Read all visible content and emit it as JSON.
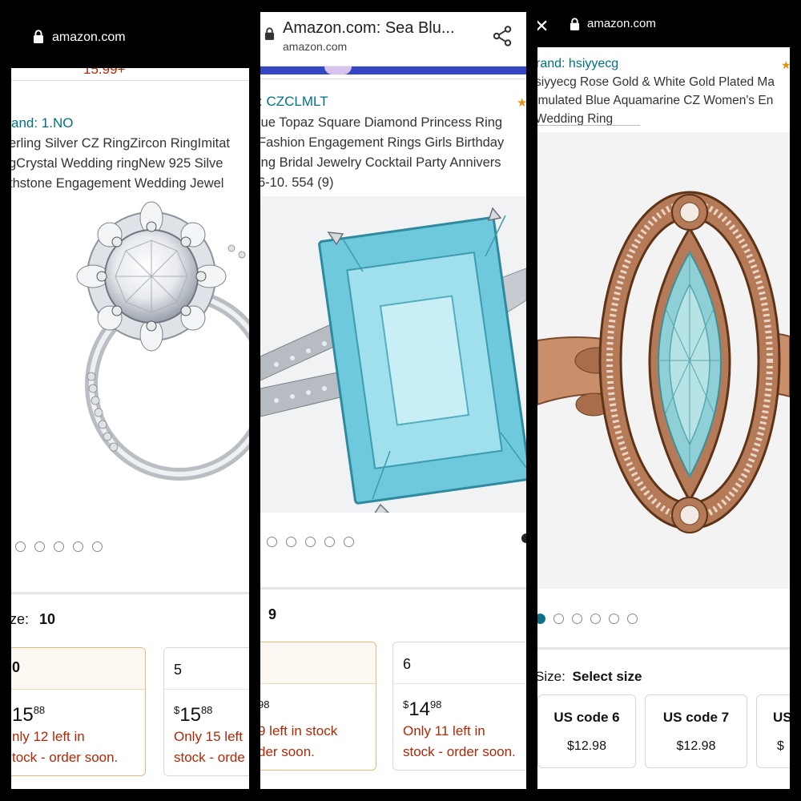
{
  "panels": [
    {
      "url": "amazon.com",
      "price_peek": "15.99+",
      "brand": "and: 1.NO",
      "title_lines": [
        "erling Silver CZ RingZircon RingImitat",
        "gCrystal Wedding ringNew 925 Silve",
        "thstone Engagement Wedding Jewel"
      ],
      "image_label": "silver-cz-ring-image",
      "size_label": "ze:",
      "size_value": "10",
      "cards": [
        {
          "size": "0",
          "price_sym": "",
          "price_whole": "15",
          "price_frac": "88",
          "stock_lines": [
            "nly 12 left in",
            "tock - order soon."
          ]
        },
        {
          "size": "5",
          "price_sym": "$",
          "price_whole": "15",
          "price_frac": "88",
          "stock_lines": [
            "Only 15 left",
            "stock - orde"
          ]
        }
      ]
    },
    {
      "title": "Amazon.com: Sea Blu...",
      "url": "amazon.com",
      "brand": ": CZCLMLT",
      "title_lines": [
        "lue Topaz Square Diamond Princess Ring",
        "Fashion Engagement Rings Girls Birthday",
        "ing Bridal Jewelry Cocktail Party Annivers",
        "6-10. 554 (9)"
      ],
      "image_label": "blue-topaz-ring-image",
      "size_value": "9",
      "cards": [
        {
          "size": "",
          "price_sym": "",
          "price_whole": "",
          "price_frac": "98",
          "stock_lines": [
            "9 left in stock",
            "der soon."
          ]
        },
        {
          "size": "6",
          "price_sym": "$",
          "price_whole": "14",
          "price_frac": "98",
          "stock_lines": [
            "Only 11 left in",
            "stock - order soon."
          ]
        }
      ]
    },
    {
      "url": "amazon.com",
      "brand": "rand: hsiyyecg",
      "title_lines": [
        "siyyecg Rose Gold & White Gold Plated Ma",
        "imulated Blue Aquamarine CZ Women's En",
        "Wedding Ring"
      ],
      "image_label": "rose-gold-aquamarine-ring-image",
      "size_label": "Size:",
      "size_value": "Select size",
      "cards": [
        {
          "size": "US code 6",
          "price": "$12.98"
        },
        {
          "size": "US code 7",
          "price": "$12.98"
        },
        {
          "size": "US",
          "price": "$"
        }
      ]
    }
  ],
  "colors": {
    "brand_link": "#007185",
    "stock_warning": "#b12704",
    "selected_border": "#e7b873",
    "dot_active": "#0b7285"
  }
}
